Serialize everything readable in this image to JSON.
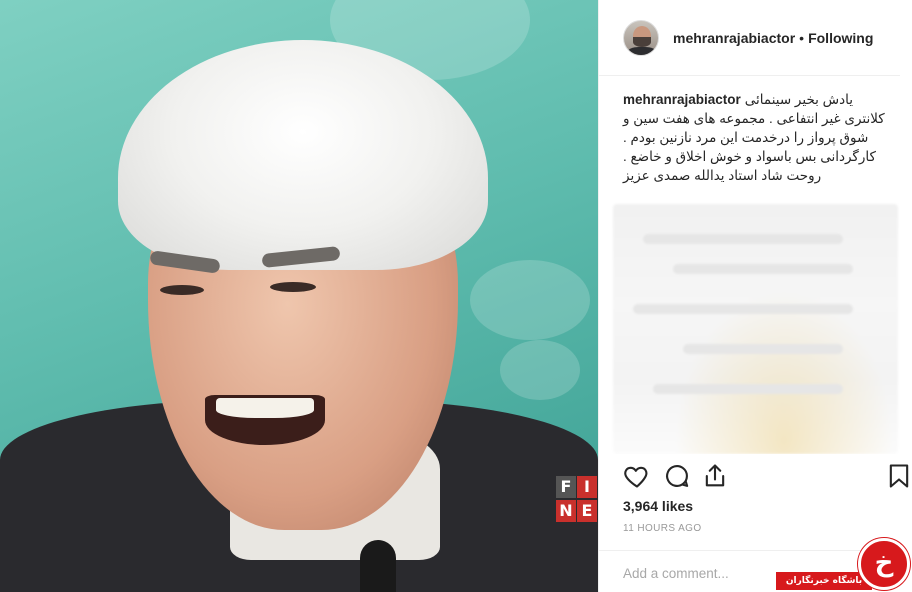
{
  "post": {
    "username": "mehranrajabiactor",
    "separator": "•",
    "follow_status": "Following",
    "caption_text": "یادش بخیر سینمائی کلانتری غیر انتفاعی . مجموعه های هفت سین و شوق پرواز را درخدمت این مرد نازنین بودم . کارگردانی بس باسواد و خوش اخلاق و خاضع . روحت شاد استاد یدالله صمدی عزیز",
    "likes": "3,964 likes",
    "time_ago": "11 HOURS AGO",
    "comment_placeholder": "Add a comment..."
  },
  "photo": {
    "festival_badge": [
      "F",
      "I",
      "N",
      "E"
    ]
  },
  "actions": {
    "icons": [
      "heart-icon",
      "comment-icon",
      "share-icon",
      "bookmark-icon"
    ]
  },
  "watermark": {
    "ribbon_text": "باشگاه خبرنگاران",
    "logo_glyph": "خ"
  },
  "colors": {
    "text": "#262626",
    "muted": "#999999",
    "border": "#efefef",
    "watermark_red": "#d7191c",
    "photo_bg": "#5fbcae"
  }
}
